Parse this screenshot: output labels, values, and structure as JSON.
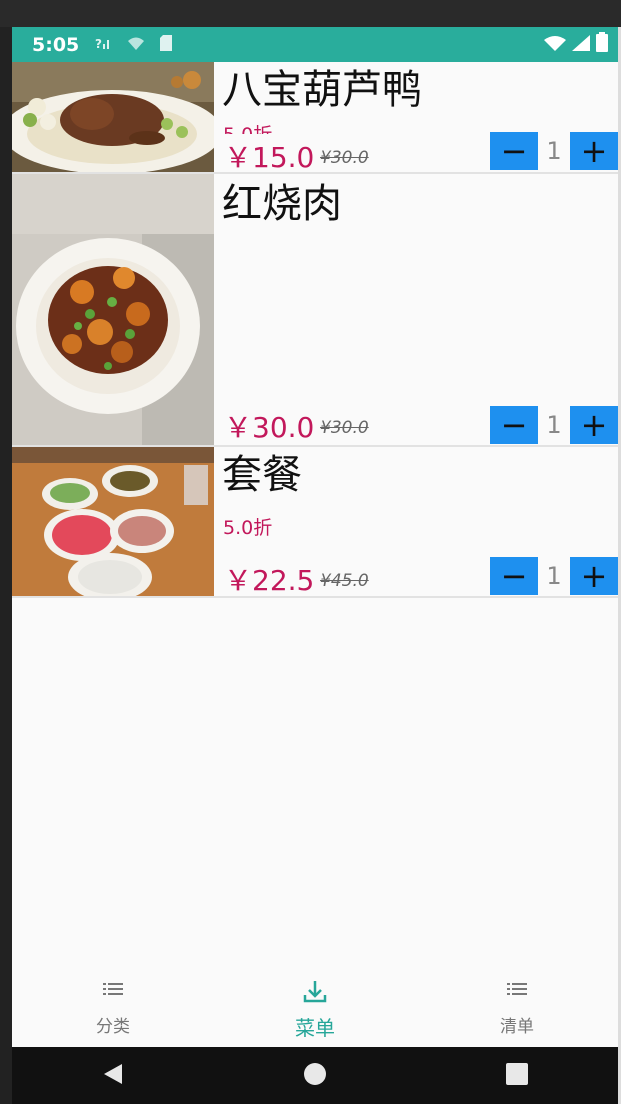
{
  "status_bar": {
    "time": "5:05"
  },
  "dishes": [
    {
      "name": "八宝葫芦鸭",
      "discount": "5.0折",
      "price": "￥15.0",
      "original_price": "¥30.0",
      "quantity": "1"
    },
    {
      "name": "红烧肉",
      "discount": "",
      "price": "￥30.0",
      "original_price": "¥30.0",
      "quantity": "1"
    },
    {
      "name": "套餐",
      "discount": "5.0折",
      "price": "￥22.5",
      "original_price": "¥45.0",
      "quantity": "1"
    }
  ],
  "qty_controls": {
    "minus": "−",
    "plus": "+"
  },
  "bottom_nav": {
    "items": [
      {
        "label": "分类",
        "icon": "list-icon"
      },
      {
        "label": "菜单",
        "icon": "download-icon"
      },
      {
        "label": "清单",
        "icon": "list-icon"
      }
    ],
    "active_index": 1
  },
  "colors": {
    "status_bar": "#29ad9c",
    "accent": "#26a699",
    "price": "#c2185b",
    "qty_button": "#1e90ef"
  }
}
